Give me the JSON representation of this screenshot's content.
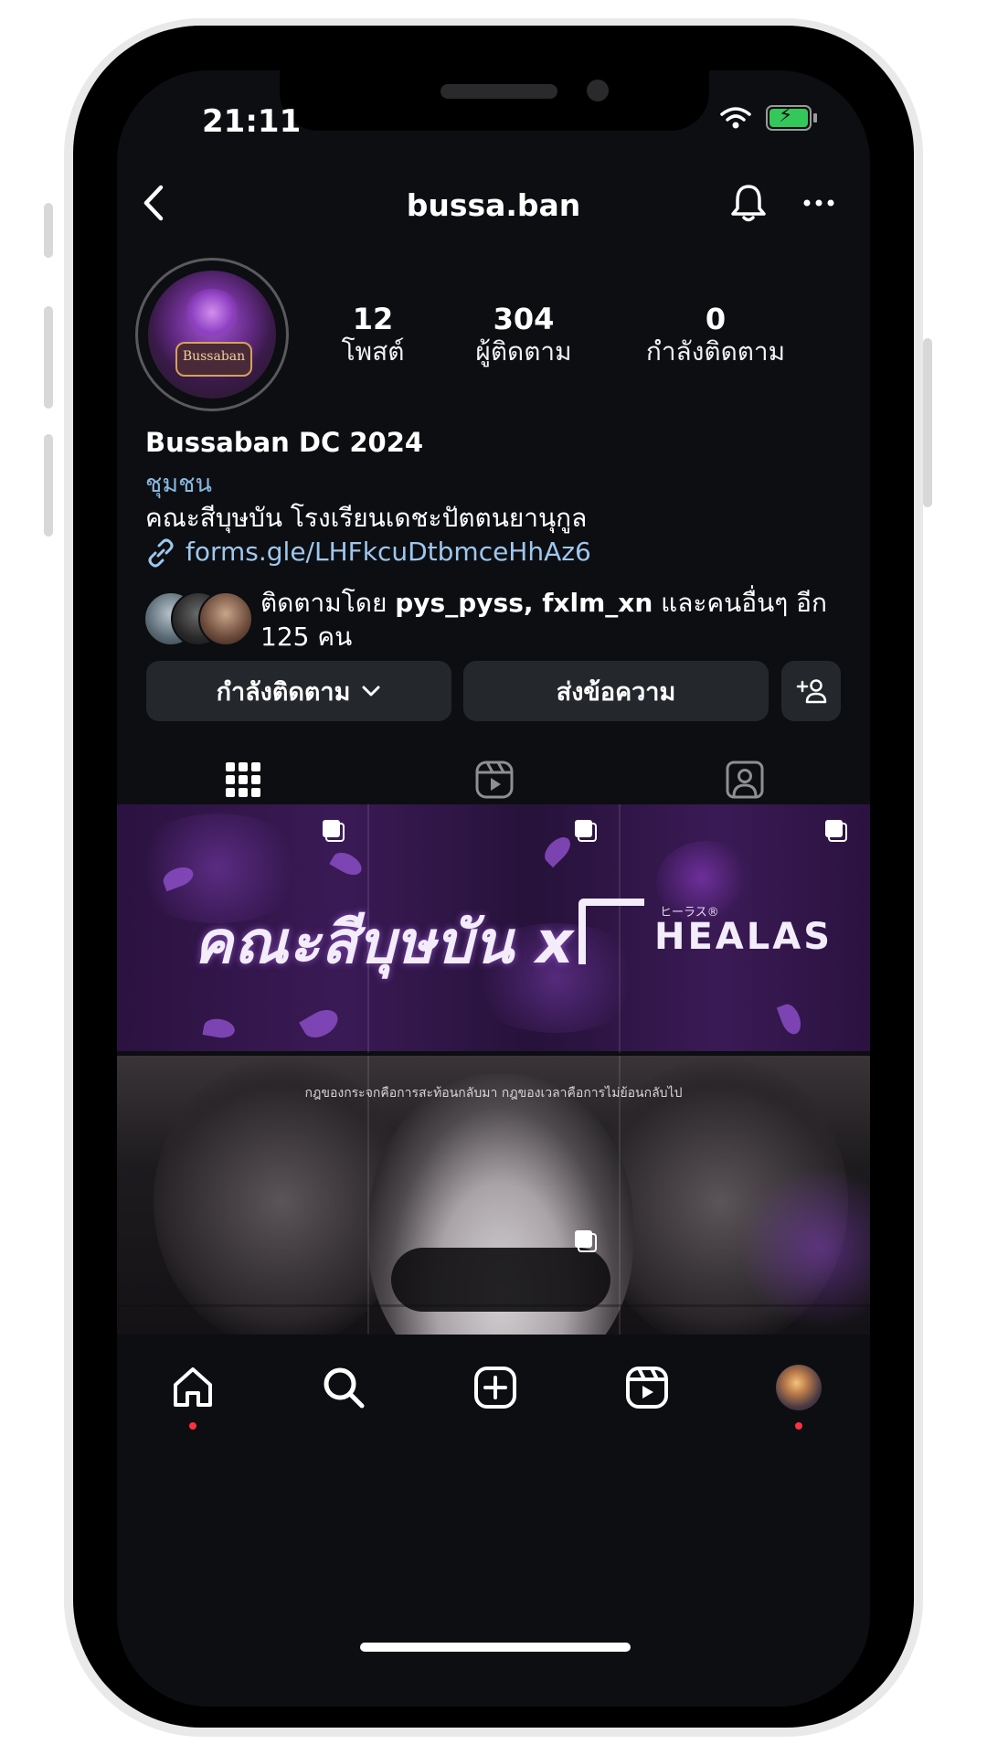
{
  "status_bar": {
    "time": "21:11"
  },
  "header": {
    "username": "bussa.ban"
  },
  "profile": {
    "avatar_text": "Bussaban",
    "stats": [
      {
        "value": "12",
        "label": "โพสต์"
      },
      {
        "value": "304",
        "label": "ผู้ติดตาม"
      },
      {
        "value": "0",
        "label": "กำลังติดตาม"
      }
    ],
    "display_name": "Bussaban DC 2024",
    "category": "ชุมชน",
    "bio": "คณะสีบุษบัน โรงเรียนเดชะปัตตนยานุกูล",
    "link": "forms.gle/LHFkcuDtbmceHhAz6",
    "followed_by_prefix": "ติดตามโดย ",
    "followed_by_names": "pys_pyss, fxlm_xn",
    "followed_by_suffix": " และคนอื่นๆ อีก 125 คน"
  },
  "actions": {
    "following_label": "กำลังติดตาม",
    "message_label": "ส่งข้อความ"
  },
  "tabs": [
    {
      "icon": "grid-icon",
      "active": true
    },
    {
      "icon": "reels-icon",
      "active": false
    },
    {
      "icon": "tagged-icon",
      "active": false
    }
  ],
  "posts": {
    "banner_title": "คณะสีบุษบัน x",
    "banner_brand": "HEALAS",
    "banner_brand_small": "ヒーラス®",
    "art_caption": "กฎของกระจกคือการสะท้อนกลับมา กฎของเวลาคือการไม่ย้อนกลับไป"
  },
  "bottom_nav": [
    {
      "icon": "home-icon",
      "dot": true
    },
    {
      "icon": "search-icon",
      "dot": false
    },
    {
      "icon": "create-icon",
      "dot": false
    },
    {
      "icon": "reels-icon",
      "dot": false
    },
    {
      "icon": "profile-avatar",
      "dot": true
    }
  ],
  "colors": {
    "background": "#0c0e12",
    "button": "#24272c",
    "link": "#9ec7ee",
    "category": "#86b8e0",
    "notification_dot": "#ff3040"
  }
}
